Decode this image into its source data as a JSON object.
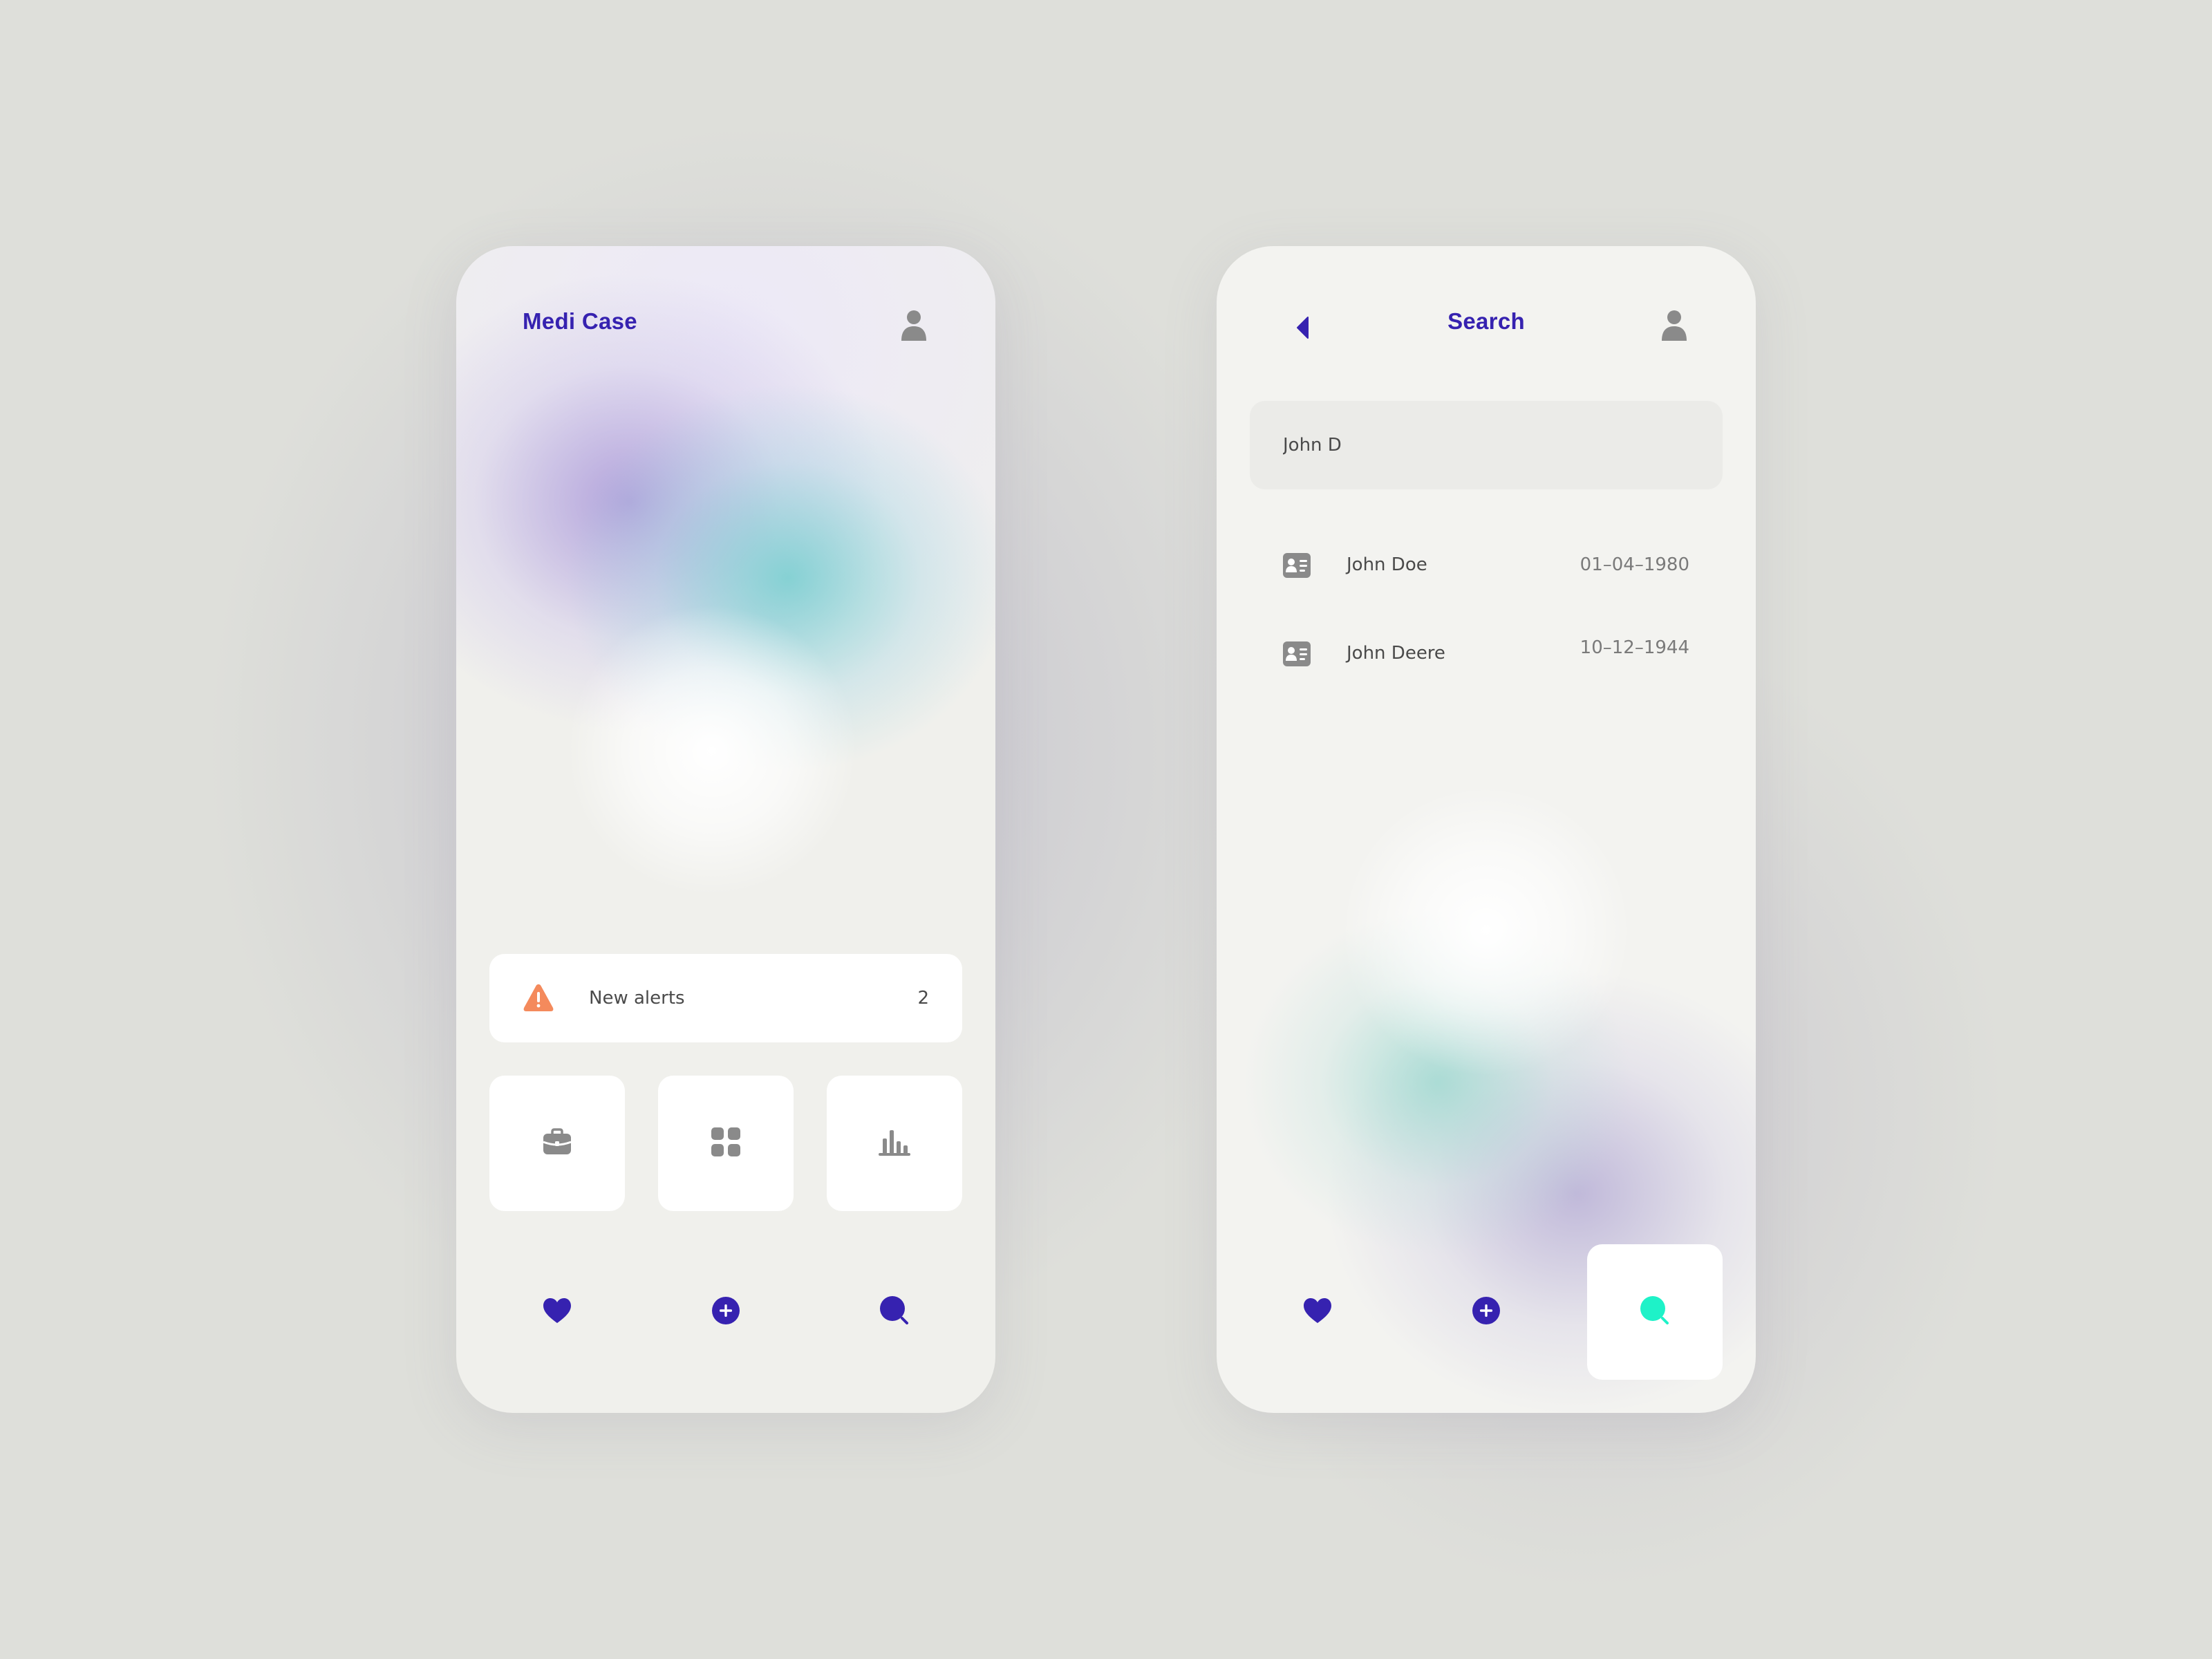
{
  "colors": {
    "background": "#dedfda",
    "brand": "#3622b0",
    "icon_gray": "#8a8a8a",
    "alert_orange": "#f48a5c",
    "active_teal": "#1ef2c8"
  },
  "home": {
    "title": "Medi Case",
    "header_icon": "user-icon",
    "alert": {
      "icon": "warning-icon",
      "label": "New alerts",
      "count": "2"
    },
    "tiles": [
      {
        "icon": "briefcase-icon"
      },
      {
        "icon": "grid-icon"
      },
      {
        "icon": "bar-chart-icon"
      }
    ]
  },
  "search_screen": {
    "title": "Search",
    "back_icon": "back-arrow-icon",
    "header_icon": "user-icon",
    "query": "John D",
    "results": [
      {
        "icon": "id-card-icon",
        "name": "John Doe",
        "date": "01–04–1980"
      },
      {
        "icon": "id-card-icon",
        "name": "John Deere",
        "date": "10–12–1944"
      }
    ]
  },
  "bottom_nav": [
    {
      "icon": "heart-icon"
    },
    {
      "icon": "plus-circle-icon"
    },
    {
      "icon": "search-icon"
    }
  ],
  "right_active_nav": "search-icon"
}
